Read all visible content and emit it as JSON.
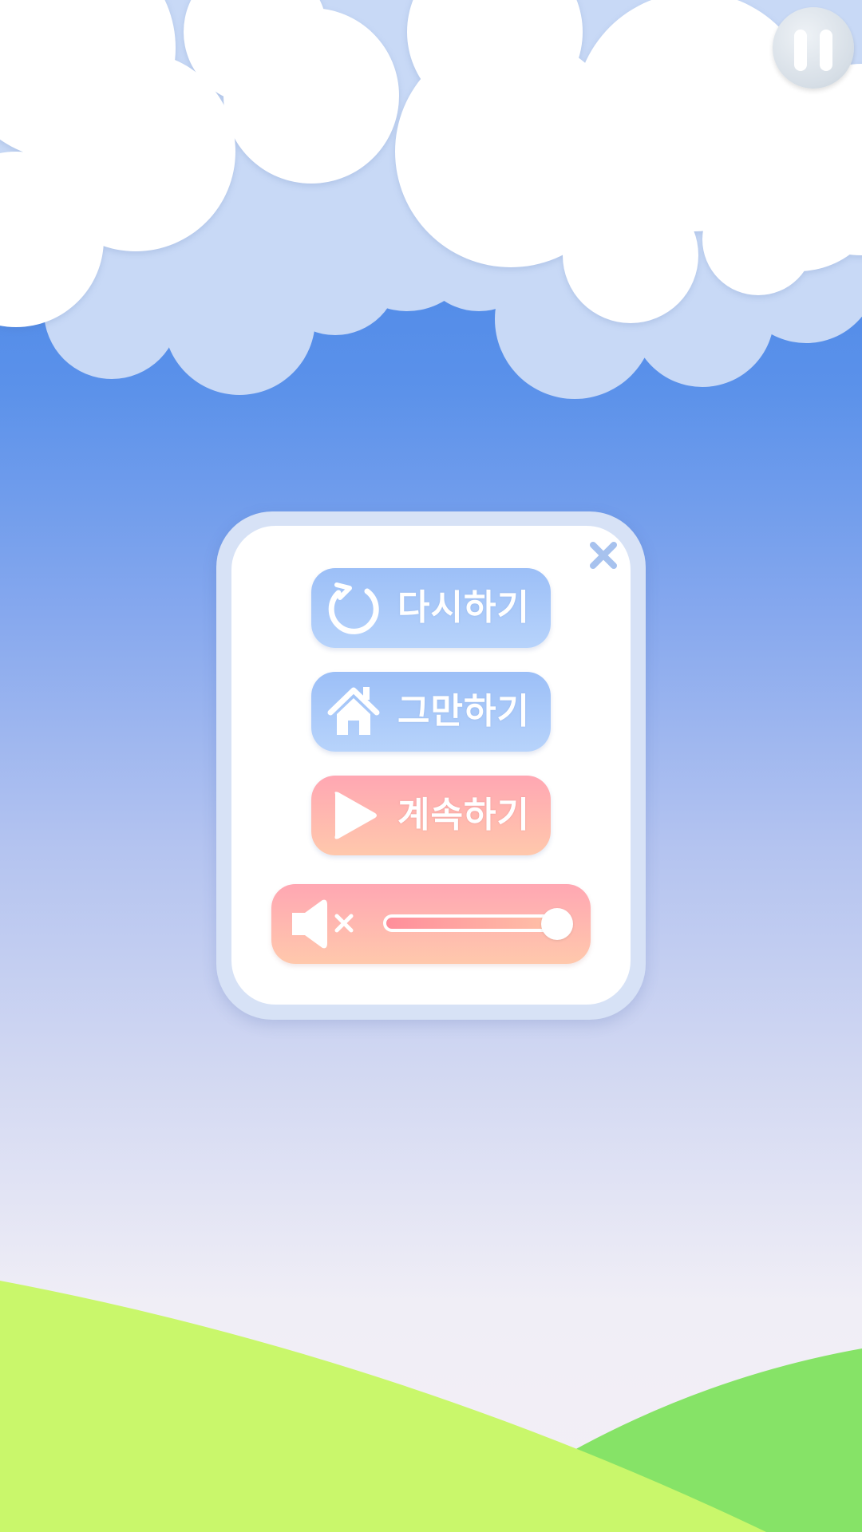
{
  "menu": {
    "restart_label": "다시하기",
    "quit_label": "그만하기",
    "continue_label": "계속하기"
  },
  "volume": {
    "level": 1.0,
    "muted_icon": "speaker-mute-icon"
  },
  "icons": {
    "pause": "pause-icon",
    "close": "close-icon",
    "restart": "restart-icon",
    "home": "home-icon",
    "play": "play-icon"
  },
  "colors": {
    "blue_button": "#a9c8f9",
    "pink_button": "#ffb5b0",
    "panel_border": "#d7e2f6",
    "close_icon": "#a7c2ee"
  }
}
